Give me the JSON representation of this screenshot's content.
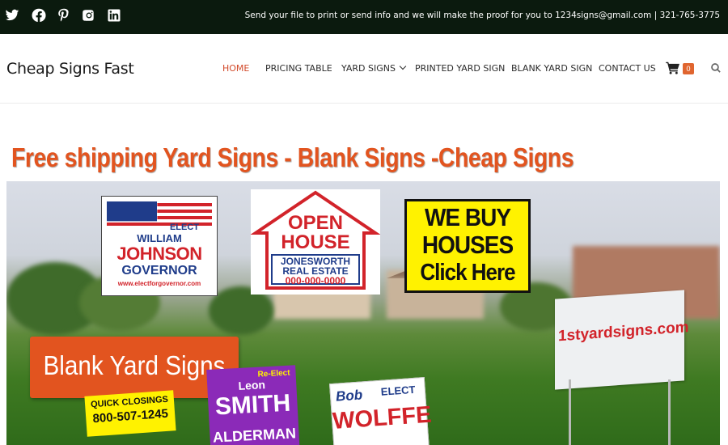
{
  "social": [
    "twitter-icon",
    "facebook-icon",
    "pinterest-icon",
    "instagram-icon",
    "linkedin-icon"
  ],
  "topbar": {
    "message": "Send your file to print or send info and we will make the proof for you to 1234signs@gmail.com | 321-765-3775"
  },
  "header": {
    "logo": "Cheap Signs Fast",
    "nav": [
      {
        "label": "HOME",
        "active": true
      },
      {
        "label": "PRICING TABLE",
        "active": false
      },
      {
        "label": "YARD SIGNS",
        "active": false,
        "dropdown": true
      },
      {
        "label": "PRINTED YARD SIGN",
        "active": false
      },
      {
        "label": "BLANK YARD SIGN",
        "active": false
      },
      {
        "label": "CONTACT US",
        "active": false
      }
    ],
    "cart_count": "0"
  },
  "headline": "Free shipping Yard Signs - Blank Signs -Cheap Signs",
  "hero": {
    "sign_elect": {
      "line1": "ELECT",
      "line2": "WILLIAM",
      "line3": "JOHNSON",
      "line4": "GOVERNOR",
      "line5": "www.electforgovernor.com"
    },
    "sign_open": {
      "line1": "OPEN",
      "line2": "HOUSE",
      "line3": "JONESWORTH",
      "line4": "REAL ESTATE",
      "line5": "000-000-0000"
    },
    "sign_buy": {
      "line1": "WE BUY",
      "line2": "HOUSES",
      "line3": "Click Here"
    },
    "sign_site": "1styardsigns.com",
    "blank_label": "Blank Yard Signs",
    "sign_quick": {
      "line1": "QUICK CLOSINGS",
      "line2": "800-507-1245"
    },
    "sign_leon": {
      "line1": "Re-Elect",
      "line2": "Leon",
      "line3": "SMITH",
      "line4": "ALDERMAN"
    },
    "sign_bob": {
      "line1": "Bob",
      "line2": "ELECT",
      "line3": "WOLFFE"
    }
  },
  "colors": {
    "accent": "#e2541f",
    "topbar": "#0b1a0e",
    "nav_active": "#d24a2a",
    "badge": "#e0652f"
  }
}
